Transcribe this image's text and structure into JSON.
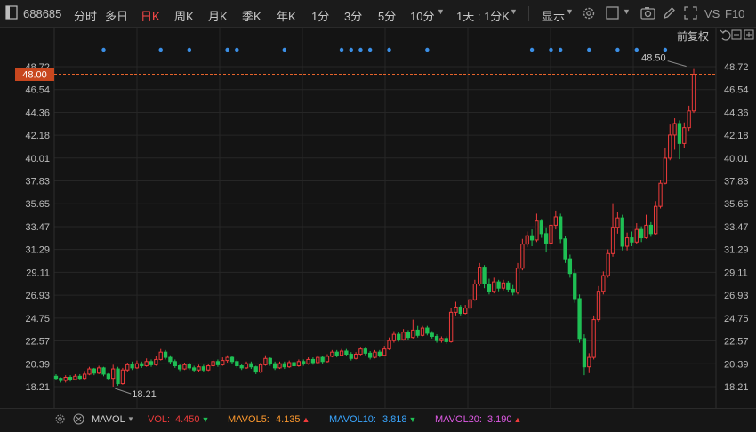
{
  "toolbar": {
    "code": "688685",
    "tabs": [
      "分时",
      "多日",
      "日K",
      "周K",
      "月K",
      "季K",
      "年K",
      "1分",
      "3分",
      "5分",
      "10分",
      "1天 : 1分K"
    ],
    "active_tab": "日K",
    "display_label": "显示",
    "vs_label": "VS",
    "f10_label": "F10"
  },
  "chart_header": {
    "restore_label": "前复权"
  },
  "colors": {
    "up": "#ee3b3b",
    "down": "#1fbf54",
    "dot": "#3b8fe6",
    "grid": "#262626",
    "axis_text": "#bdbdbd",
    "price_marker": "#e8632b"
  },
  "price_marker": {
    "value": 48.0,
    "label": "48.00"
  },
  "status": {
    "mavol_label": "MAVOL",
    "vol_label": "VOL:",
    "vol_value": "4.450",
    "mavol5_label": "MAVOL5:",
    "mavol5_value": "4.135",
    "mavol10_label": "MAVOL10:",
    "mavol10_value": "3.818",
    "mavol20_label": "MAVOL20:",
    "mavol20_value": "3.190"
  },
  "chart_data": {
    "type": "candlestick",
    "y_ticks": [
      "48.72",
      "46.54",
      "44.36",
      "42.18",
      "40.01",
      "37.83",
      "35.65",
      "33.47",
      "31.29",
      "29.11",
      "26.93",
      "24.75",
      "22.57",
      "20.39",
      "18.21"
    ],
    "ylim": [
      18.21,
      48.72
    ],
    "annotations": [
      {
        "label": "48.50",
        "value": 48.5,
        "index": 133
      },
      {
        "label": "18.21",
        "value": 18.21,
        "index": 12
      }
    ],
    "dot_markers": [
      10,
      22,
      28,
      36,
      38,
      48,
      60,
      62,
      64,
      66,
      70,
      78,
      100,
      104,
      106,
      112,
      118,
      122,
      128
    ],
    "candles": [
      {
        "o": 19.2,
        "c": 19.0,
        "h": 19.4,
        "l": 18.8
      },
      {
        "o": 19.0,
        "c": 18.8,
        "h": 19.1,
        "l": 18.6
      },
      {
        "o": 18.8,
        "c": 19.1,
        "h": 19.3,
        "l": 18.6
      },
      {
        "o": 19.1,
        "c": 18.9,
        "h": 19.3,
        "l": 18.7
      },
      {
        "o": 18.9,
        "c": 19.2,
        "h": 19.4,
        "l": 18.8
      },
      {
        "o": 19.2,
        "c": 19.0,
        "h": 19.4,
        "l": 18.9
      },
      {
        "o": 19.0,
        "c": 19.4,
        "h": 19.7,
        "l": 18.9
      },
      {
        "o": 19.4,
        "c": 19.9,
        "h": 20.1,
        "l": 19.3
      },
      {
        "o": 19.9,
        "c": 19.5,
        "h": 20.0,
        "l": 19.3
      },
      {
        "o": 19.5,
        "c": 20.0,
        "h": 20.2,
        "l": 19.4
      },
      {
        "o": 20.0,
        "c": 19.4,
        "h": 20.1,
        "l": 19.2
      },
      {
        "o": 19.4,
        "c": 19.0,
        "h": 19.5,
        "l": 18.8
      },
      {
        "o": 19.0,
        "c": 19.9,
        "h": 20.3,
        "l": 18.21
      },
      {
        "o": 19.9,
        "c": 18.5,
        "h": 20.1,
        "l": 18.3
      },
      {
        "o": 18.5,
        "c": 19.8,
        "h": 20.0,
        "l": 18.4
      },
      {
        "o": 19.8,
        "c": 20.3,
        "h": 20.5,
        "l": 19.6
      },
      {
        "o": 20.3,
        "c": 20.0,
        "h": 20.6,
        "l": 19.8
      },
      {
        "o": 20.0,
        "c": 20.4,
        "h": 20.7,
        "l": 19.9
      },
      {
        "o": 20.4,
        "c": 20.2,
        "h": 20.6,
        "l": 20.0
      },
      {
        "o": 20.2,
        "c": 20.6,
        "h": 20.9,
        "l": 20.1
      },
      {
        "o": 20.6,
        "c": 20.3,
        "h": 20.8,
        "l": 20.1
      },
      {
        "o": 20.3,
        "c": 20.8,
        "h": 21.1,
        "l": 20.2
      },
      {
        "o": 20.8,
        "c": 21.5,
        "h": 21.8,
        "l": 20.7
      },
      {
        "o": 21.5,
        "c": 21.0,
        "h": 21.7,
        "l": 20.8
      },
      {
        "o": 21.0,
        "c": 20.6,
        "h": 21.2,
        "l": 20.4
      },
      {
        "o": 20.6,
        "c": 20.2,
        "h": 20.8,
        "l": 20.0
      },
      {
        "o": 20.2,
        "c": 19.9,
        "h": 20.4,
        "l": 19.7
      },
      {
        "o": 19.9,
        "c": 20.3,
        "h": 20.5,
        "l": 19.8
      },
      {
        "o": 20.3,
        "c": 20.0,
        "h": 20.5,
        "l": 19.8
      },
      {
        "o": 20.0,
        "c": 19.8,
        "h": 20.2,
        "l": 19.6
      },
      {
        "o": 19.8,
        "c": 20.1,
        "h": 20.3,
        "l": 19.6
      },
      {
        "o": 20.1,
        "c": 19.8,
        "h": 20.3,
        "l": 19.6
      },
      {
        "o": 19.8,
        "c": 20.2,
        "h": 20.4,
        "l": 19.7
      },
      {
        "o": 20.2,
        "c": 20.6,
        "h": 20.8,
        "l": 20.0
      },
      {
        "o": 20.6,
        "c": 20.3,
        "h": 20.8,
        "l": 20.1
      },
      {
        "o": 20.3,
        "c": 20.7,
        "h": 21.0,
        "l": 20.2
      },
      {
        "o": 20.7,
        "c": 21.0,
        "h": 21.2,
        "l": 20.5
      },
      {
        "o": 21.0,
        "c": 20.6,
        "h": 21.1,
        "l": 20.4
      },
      {
        "o": 20.6,
        "c": 20.2,
        "h": 20.8,
        "l": 20.0
      },
      {
        "o": 20.2,
        "c": 20.0,
        "h": 20.4,
        "l": 19.8
      },
      {
        "o": 20.0,
        "c": 20.4,
        "h": 20.6,
        "l": 19.9
      },
      {
        "o": 20.4,
        "c": 20.1,
        "h": 20.6,
        "l": 19.9
      },
      {
        "o": 20.1,
        "c": 19.6,
        "h": 20.2,
        "l": 19.4
      },
      {
        "o": 19.6,
        "c": 20.3,
        "h": 20.5,
        "l": 19.5
      },
      {
        "o": 20.3,
        "c": 20.9,
        "h": 21.2,
        "l": 20.2
      },
      {
        "o": 20.9,
        "c": 20.4,
        "h": 21.0,
        "l": 20.2
      },
      {
        "o": 20.4,
        "c": 20.0,
        "h": 20.6,
        "l": 19.8
      },
      {
        "o": 20.0,
        "c": 20.4,
        "h": 20.6,
        "l": 19.9
      },
      {
        "o": 20.4,
        "c": 20.1,
        "h": 20.6,
        "l": 19.9
      },
      {
        "o": 20.1,
        "c": 20.5,
        "h": 20.7,
        "l": 20.0
      },
      {
        "o": 20.5,
        "c": 20.2,
        "h": 20.7,
        "l": 20.0
      },
      {
        "o": 20.2,
        "c": 20.6,
        "h": 20.8,
        "l": 20.1
      },
      {
        "o": 20.6,
        "c": 20.4,
        "h": 20.8,
        "l": 20.2
      },
      {
        "o": 20.4,
        "c": 20.8,
        "h": 21.0,
        "l": 20.3
      },
      {
        "o": 20.8,
        "c": 20.5,
        "h": 21.0,
        "l": 20.3
      },
      {
        "o": 20.5,
        "c": 21.0,
        "h": 21.2,
        "l": 20.4
      },
      {
        "o": 21.0,
        "c": 20.6,
        "h": 21.1,
        "l": 20.4
      },
      {
        "o": 20.6,
        "c": 21.1,
        "h": 21.3,
        "l": 20.5
      },
      {
        "o": 21.1,
        "c": 21.5,
        "h": 21.7,
        "l": 21.0
      },
      {
        "o": 21.5,
        "c": 21.2,
        "h": 21.7,
        "l": 21.0
      },
      {
        "o": 21.2,
        "c": 21.6,
        "h": 21.8,
        "l": 21.1
      },
      {
        "o": 21.6,
        "c": 21.3,
        "h": 21.8,
        "l": 21.1
      },
      {
        "o": 21.3,
        "c": 20.9,
        "h": 21.5,
        "l": 20.7
      },
      {
        "o": 20.9,
        "c": 21.3,
        "h": 21.5,
        "l": 20.8
      },
      {
        "o": 21.3,
        "c": 21.8,
        "h": 22.0,
        "l": 21.2
      },
      {
        "o": 21.8,
        "c": 21.4,
        "h": 22.0,
        "l": 21.2
      },
      {
        "o": 21.4,
        "c": 21.0,
        "h": 21.6,
        "l": 20.8
      },
      {
        "o": 21.0,
        "c": 21.5,
        "h": 21.7,
        "l": 20.9
      },
      {
        "o": 21.5,
        "c": 21.2,
        "h": 21.7,
        "l": 21.0
      },
      {
        "o": 21.2,
        "c": 21.8,
        "h": 22.1,
        "l": 21.1
      },
      {
        "o": 21.8,
        "c": 22.6,
        "h": 22.9,
        "l": 21.7
      },
      {
        "o": 22.6,
        "c": 23.2,
        "h": 23.5,
        "l": 22.4
      },
      {
        "o": 23.2,
        "c": 22.7,
        "h": 23.4,
        "l": 22.5
      },
      {
        "o": 22.7,
        "c": 23.4,
        "h": 23.7,
        "l": 22.6
      },
      {
        "o": 23.4,
        "c": 22.9,
        "h": 23.6,
        "l": 22.7
      },
      {
        "o": 22.9,
        "c": 23.6,
        "h": 24.6,
        "l": 22.8
      },
      {
        "o": 23.6,
        "c": 23.1,
        "h": 24.0,
        "l": 22.9
      },
      {
        "o": 23.1,
        "c": 23.8,
        "h": 24.0,
        "l": 23.0
      },
      {
        "o": 23.8,
        "c": 23.3,
        "h": 24.0,
        "l": 23.1
      },
      {
        "o": 23.3,
        "c": 23.0,
        "h": 23.5,
        "l": 22.8
      },
      {
        "o": 23.0,
        "c": 22.6,
        "h": 23.2,
        "l": 22.4
      },
      {
        "o": 22.6,
        "c": 22.8,
        "h": 23.0,
        "l": 22.4
      },
      {
        "o": 22.8,
        "c": 22.5,
        "h": 23.0,
        "l": 22.3
      },
      {
        "o": 22.5,
        "c": 25.3,
        "h": 25.7,
        "l": 22.4
      },
      {
        "o": 25.3,
        "c": 25.8,
        "h": 26.3,
        "l": 25.0
      },
      {
        "o": 25.8,
        "c": 25.2,
        "h": 26.0,
        "l": 25.0
      },
      {
        "o": 25.2,
        "c": 25.7,
        "h": 26.0,
        "l": 25.1
      },
      {
        "o": 25.7,
        "c": 26.5,
        "h": 26.9,
        "l": 25.6
      },
      {
        "o": 26.5,
        "c": 28.0,
        "h": 28.4,
        "l": 26.4
      },
      {
        "o": 28.0,
        "c": 29.6,
        "h": 30.0,
        "l": 27.8
      },
      {
        "o": 29.6,
        "c": 28.0,
        "h": 29.8,
        "l": 27.6
      },
      {
        "o": 28.0,
        "c": 27.3,
        "h": 28.5,
        "l": 27.0
      },
      {
        "o": 27.3,
        "c": 28.2,
        "h": 28.6,
        "l": 27.1
      },
      {
        "o": 28.2,
        "c": 27.6,
        "h": 28.4,
        "l": 27.3
      },
      {
        "o": 27.6,
        "c": 28.1,
        "h": 28.4,
        "l": 27.4
      },
      {
        "o": 28.1,
        "c": 27.5,
        "h": 28.3,
        "l": 27.2
      },
      {
        "o": 27.5,
        "c": 27.2,
        "h": 27.9,
        "l": 26.9
      },
      {
        "o": 27.2,
        "c": 29.5,
        "h": 30.0,
        "l": 27.0
      },
      {
        "o": 29.5,
        "c": 31.8,
        "h": 32.3,
        "l": 29.3
      },
      {
        "o": 31.8,
        "c": 32.6,
        "h": 33.0,
        "l": 31.5
      },
      {
        "o": 32.6,
        "c": 32.2,
        "h": 33.2,
        "l": 31.6
      },
      {
        "o": 32.2,
        "c": 34.0,
        "h": 34.7,
        "l": 32.0
      },
      {
        "o": 34.0,
        "c": 32.8,
        "h": 34.2,
        "l": 32.4
      },
      {
        "o": 32.8,
        "c": 31.9,
        "h": 33.4,
        "l": 31.0
      },
      {
        "o": 31.9,
        "c": 33.6,
        "h": 34.9,
        "l": 31.7
      },
      {
        "o": 33.6,
        "c": 34.4,
        "h": 35.0,
        "l": 33.2
      },
      {
        "o": 34.4,
        "c": 32.3,
        "h": 34.7,
        "l": 31.9
      },
      {
        "o": 32.3,
        "c": 30.4,
        "h": 32.6,
        "l": 30.0
      },
      {
        "o": 30.4,
        "c": 29.0,
        "h": 30.8,
        "l": 28.6
      },
      {
        "o": 29.0,
        "c": 26.6,
        "h": 29.4,
        "l": 26.2
      },
      {
        "o": 26.6,
        "c": 22.8,
        "h": 27.0,
        "l": 22.4
      },
      {
        "o": 22.8,
        "c": 20.1,
        "h": 23.2,
        "l": 19.3
      },
      {
        "o": 20.1,
        "c": 21.0,
        "h": 21.4,
        "l": 19.5
      },
      {
        "o": 21.0,
        "c": 24.6,
        "h": 25.0,
        "l": 20.8
      },
      {
        "o": 24.6,
        "c": 27.3,
        "h": 27.8,
        "l": 24.4
      },
      {
        "o": 27.3,
        "c": 28.8,
        "h": 29.2,
        "l": 27.0
      },
      {
        "o": 28.8,
        "c": 30.9,
        "h": 31.3,
        "l": 28.6
      },
      {
        "o": 30.9,
        "c": 33.4,
        "h": 35.7,
        "l": 30.6
      },
      {
        "o": 33.4,
        "c": 34.3,
        "h": 34.9,
        "l": 32.8
      },
      {
        "o": 34.3,
        "c": 31.6,
        "h": 34.6,
        "l": 31.2
      },
      {
        "o": 31.6,
        "c": 32.4,
        "h": 32.9,
        "l": 31.2
      },
      {
        "o": 32.4,
        "c": 32.0,
        "h": 33.0,
        "l": 31.6
      },
      {
        "o": 32.0,
        "c": 33.2,
        "h": 33.8,
        "l": 31.8
      },
      {
        "o": 33.2,
        "c": 32.4,
        "h": 33.5,
        "l": 32.0
      },
      {
        "o": 32.4,
        "c": 33.6,
        "h": 34.6,
        "l": 32.3
      },
      {
        "o": 33.6,
        "c": 32.8,
        "h": 33.9,
        "l": 32.5
      },
      {
        "o": 32.8,
        "c": 35.4,
        "h": 35.9,
        "l": 32.7
      },
      {
        "o": 35.4,
        "c": 37.6,
        "h": 37.9,
        "l": 35.2
      },
      {
        "o": 37.6,
        "c": 40.0,
        "h": 41.0,
        "l": 37.5
      },
      {
        "o": 40.0,
        "c": 42.2,
        "h": 43.2,
        "l": 39.8
      },
      {
        "o": 42.2,
        "c": 43.3,
        "h": 43.8,
        "l": 40.8
      },
      {
        "o": 43.3,
        "c": 41.4,
        "h": 43.6,
        "l": 39.9
      },
      {
        "o": 41.4,
        "c": 42.9,
        "h": 43.4,
        "l": 41.0
      },
      {
        "o": 42.9,
        "c": 44.5,
        "h": 45.0,
        "l": 42.6
      },
      {
        "o": 44.5,
        "c": 48.0,
        "h": 48.5,
        "l": 44.3
      }
    ]
  }
}
